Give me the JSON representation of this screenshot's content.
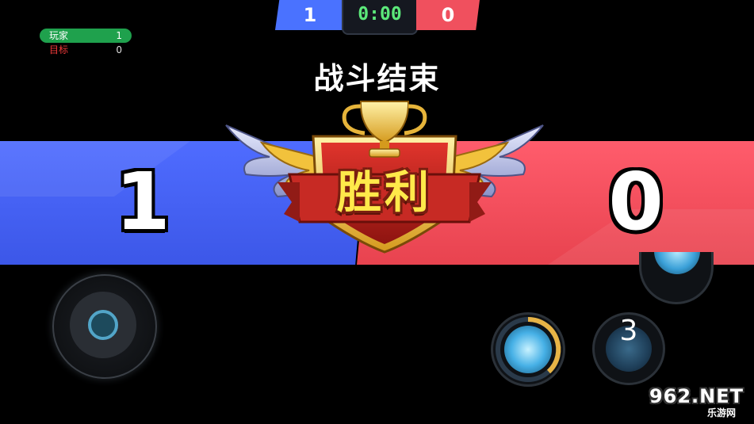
{
  "scoreboard": {
    "blue_score": "1",
    "timer": "0:00",
    "red_score": "0"
  },
  "stats": [
    {
      "label": "玩家",
      "value": "1"
    },
    {
      "label": "目标",
      "value": "0"
    }
  ],
  "title": "战斗结束",
  "result": {
    "blue_score": "1",
    "red_score": "0",
    "banner": "胜利"
  },
  "skills": {
    "count_label": "3"
  },
  "watermark": {
    "domain": "962.NET",
    "sub": "乐游网"
  },
  "colors": {
    "blue": "#4f6cff",
    "red": "#ff5c6c",
    "timer": "#5ce87a",
    "gold": "#ffe94a",
    "stat_highlight": "#1fa14d"
  },
  "icons": [
    "trophy-icon",
    "wing-icon",
    "joystick-icon",
    "skill-icon"
  ]
}
